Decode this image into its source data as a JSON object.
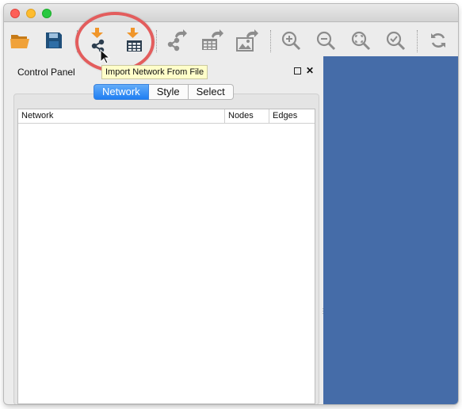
{
  "colors": {
    "accent": "#1e7ef3",
    "highlight_ring": "#e35d5d",
    "network_view": "#456ca8",
    "tooltip_bg": "#fffec9",
    "import_arrow": "#f0962b"
  },
  "toolbar": {
    "buttons": [
      {
        "icon": "open-folder-icon"
      },
      {
        "icon": "save-icon"
      },
      {
        "icon": "import-network-icon"
      },
      {
        "icon": "import-table-icon"
      },
      {
        "icon": "export-network-icon"
      },
      {
        "icon": "export-table-icon"
      },
      {
        "icon": "export-image-icon"
      },
      {
        "icon": "zoom-in-icon"
      },
      {
        "icon": "zoom-out-icon"
      },
      {
        "icon": "zoom-fit-icon"
      },
      {
        "icon": "zoom-selected-icon"
      },
      {
        "icon": "refresh-icon"
      }
    ]
  },
  "tooltip": {
    "text": "Import Network From File"
  },
  "control_panel": {
    "title": "Control Panel",
    "tabs": [
      {
        "label": "Network",
        "selected": true
      },
      {
        "label": "Style",
        "selected": false
      },
      {
        "label": "Select",
        "selected": false
      }
    ],
    "table": {
      "columns": [
        "Network",
        "Nodes",
        "Edges"
      ]
    }
  }
}
